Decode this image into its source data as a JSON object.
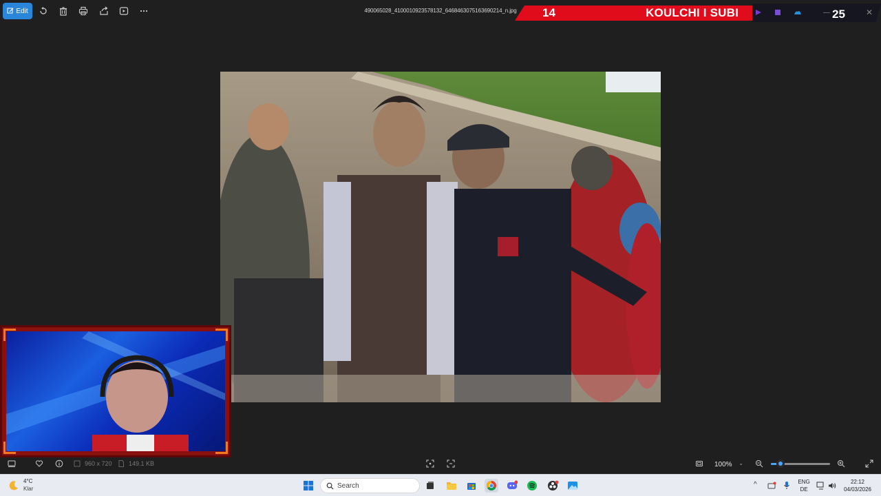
{
  "toolbar": {
    "edit_label": "Edit",
    "icons": [
      "edit-icon",
      "rotate-icon",
      "delete-icon",
      "print-icon",
      "share-icon",
      "slideshow-icon",
      "more-icon"
    ]
  },
  "file": {
    "name": "490065028_4100010923578132_6468463075163690214_n.jpg",
    "dimensions": "960 x 720",
    "size": "149.1 KB"
  },
  "overlay": {
    "left_number": "14",
    "title": "KOULCHI I SUBI",
    "right_number": "25",
    "colors": {
      "red": "#e00b1b",
      "dark": "#161620"
    }
  },
  "viewer": {
    "zoom_value": "100%",
    "zoom_slider_fraction": 0.16
  },
  "taskbar": {
    "weather_temp": "4°C",
    "weather_condition": "Klar",
    "search_placeholder": "Search",
    "language_top": "ENG",
    "language_bottom": "DE",
    "time": "22:12",
    "date": "04/03/2026"
  },
  "colors": {
    "accent": "#2a86d8",
    "background": "#1f1f1f",
    "taskbar": "#e8ecf2"
  }
}
